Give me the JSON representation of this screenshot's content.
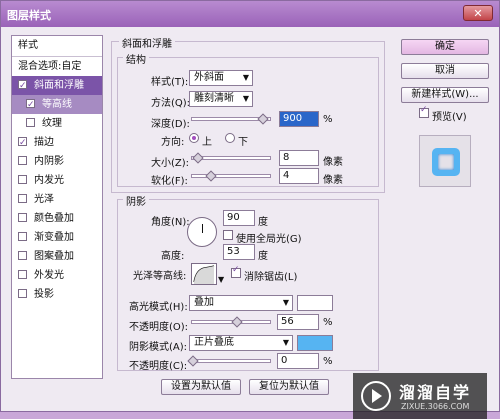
{
  "window": {
    "title": "图层样式",
    "close_label": "✕"
  },
  "left_panel": {
    "header": "样式",
    "blend_options": "混合选项:自定",
    "items": [
      {
        "label": "斜面和浮雕",
        "checked": true,
        "selected": true
      },
      {
        "label": "等高线",
        "checked": true,
        "sub": true,
        "selected_sub": true
      },
      {
        "label": "纹理",
        "checked": false,
        "sub": true
      },
      {
        "label": "描边",
        "checked": true
      },
      {
        "label": "内阴影",
        "checked": false
      },
      {
        "label": "内发光",
        "checked": false
      },
      {
        "label": "光泽",
        "checked": false
      },
      {
        "label": "颜色叠加",
        "checked": false
      },
      {
        "label": "渐变叠加",
        "checked": false
      },
      {
        "label": "图案叠加",
        "checked": false
      },
      {
        "label": "外发光",
        "checked": false
      },
      {
        "label": "投影",
        "checked": false
      }
    ]
  },
  "bevel": {
    "title": "斜面和浮雕",
    "structure": "结构",
    "style_label": "样式(T):",
    "style_value": "外斜面",
    "technique_label": "方法(Q):",
    "technique_value": "雕刻清晰",
    "depth_label": "深度(D):",
    "depth_value": "900",
    "depth_unit": "%",
    "direction_label": "方向:",
    "dir_up": "上",
    "dir_down": "下",
    "size_label": "大小(Z):",
    "size_value": "8",
    "size_unit": "像素",
    "soften_label": "软化(F):",
    "soften_value": "4",
    "soften_unit": "像素"
  },
  "shading": {
    "title": "阴影",
    "angle_label": "角度(N):",
    "angle_value": "90",
    "angle_unit": "度",
    "global_light_label": "使用全局光(G)",
    "altitude_label": "高度:",
    "altitude_value": "53",
    "altitude_unit": "度",
    "gloss_label": "光泽等高线:",
    "anti_alias_label": "消除锯齿(L)",
    "highlight_mode_label": "高光模式(H):",
    "highlight_mode_value": "叠加",
    "highlight_color": "#ffffff",
    "highlight_opacity_label": "不透明度(O):",
    "highlight_opacity_value": "56",
    "shadow_mode_label": "阴影模式(A):",
    "shadow_mode_value": "正片叠底",
    "shadow_color": "#56b4f2",
    "shadow_opacity_label": "不透明度(C):",
    "shadow_opacity_value": "0",
    "pct": "%"
  },
  "bottom_buttons": {
    "default": "设置为默认值",
    "reset": "复位为默认值"
  },
  "right_panel": {
    "ok": "确定",
    "cancel": "取消",
    "new_style": "新建样式(W)...",
    "preview": "预览(V)"
  },
  "watermark": {
    "name": "溜溜自学",
    "url": "ZIXUE.3066.COM"
  }
}
